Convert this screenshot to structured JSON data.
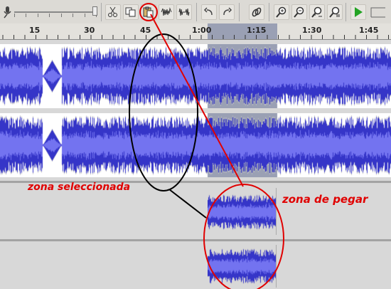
{
  "toolbar": {
    "buttons": [
      {
        "icon": "microphone-icon"
      },
      {
        "icon": "cut-icon"
      },
      {
        "icon": "copy-icon"
      },
      {
        "icon": "paste-icon"
      },
      {
        "icon": "trim-icon"
      },
      {
        "icon": "silence-icon"
      },
      {
        "icon": "undo-icon"
      },
      {
        "icon": "redo-icon"
      },
      {
        "icon": "sync-lock-icon"
      },
      {
        "icon": "zoom-in-icon"
      },
      {
        "icon": "zoom-out-icon"
      },
      {
        "icon": "fit-selection-icon"
      },
      {
        "icon": "fit-project-icon"
      },
      {
        "icon": "play-icon"
      }
    ]
  },
  "ruler": {
    "labels": [
      "15",
      "30",
      "45",
      "1:00",
      "1:15",
      "1:30",
      "1:45"
    ]
  },
  "annotations": {
    "selected_zone": "zona seleccionada",
    "paste_zone": "zona de pegar"
  },
  "colors": {
    "waveform": "#3535c8",
    "waveform_rms": "#7373f0",
    "annotation": "#e00000",
    "selection": "#9aa0b4"
  }
}
